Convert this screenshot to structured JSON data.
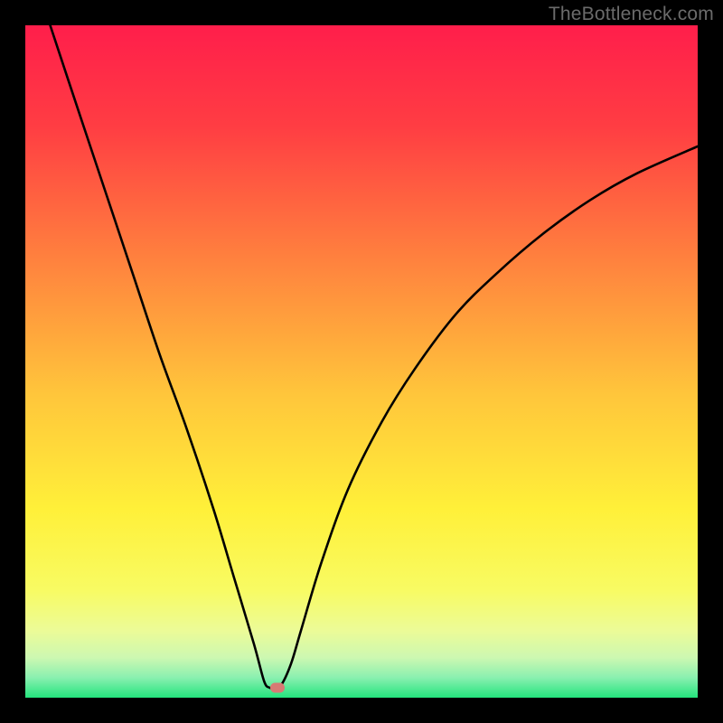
{
  "watermark": "TheBottleneck.com",
  "chart_data": {
    "type": "line",
    "title": "",
    "xlabel": "",
    "ylabel": "",
    "xlim": [
      0,
      100
    ],
    "ylim": [
      0,
      100
    ],
    "min_point": {
      "x": 37,
      "y": 0
    },
    "curve_points": [
      {
        "x": 3.7,
        "y": 100
      },
      {
        "x": 8,
        "y": 87
      },
      {
        "x": 12,
        "y": 75
      },
      {
        "x": 16,
        "y": 63
      },
      {
        "x": 20,
        "y": 51
      },
      {
        "x": 24,
        "y": 40
      },
      {
        "x": 28,
        "y": 28
      },
      {
        "x": 31,
        "y": 18
      },
      {
        "x": 34,
        "y": 8
      },
      {
        "x": 35.5,
        "y": 2.5
      },
      {
        "x": 36.3,
        "y": 1.5
      },
      {
        "x": 37,
        "y": 1.5
      },
      {
        "x": 38,
        "y": 1.8
      },
      {
        "x": 39.5,
        "y": 5
      },
      {
        "x": 41,
        "y": 10
      },
      {
        "x": 44,
        "y": 20
      },
      {
        "x": 48,
        "y": 31
      },
      {
        "x": 53,
        "y": 41
      },
      {
        "x": 58,
        "y": 49
      },
      {
        "x": 64,
        "y": 57
      },
      {
        "x": 70,
        "y": 63
      },
      {
        "x": 77,
        "y": 69
      },
      {
        "x": 84,
        "y": 74
      },
      {
        "x": 91,
        "y": 78
      },
      {
        "x": 100,
        "y": 82
      }
    ],
    "marker": {
      "x": 37.5,
      "y": 1.5,
      "color": "#d77a74"
    },
    "gradient_stops": [
      {
        "pct": 0,
        "color": "#ff1e4b"
      },
      {
        "pct": 15,
        "color": "#ff3d43"
      },
      {
        "pct": 35,
        "color": "#ff823e"
      },
      {
        "pct": 55,
        "color": "#ffc63b"
      },
      {
        "pct": 72,
        "color": "#fff039"
      },
      {
        "pct": 84,
        "color": "#f8fb63"
      },
      {
        "pct": 90,
        "color": "#ecfb97"
      },
      {
        "pct": 94,
        "color": "#cdf8b1"
      },
      {
        "pct": 97,
        "color": "#8af0b0"
      },
      {
        "pct": 100,
        "color": "#24e47d"
      }
    ]
  }
}
